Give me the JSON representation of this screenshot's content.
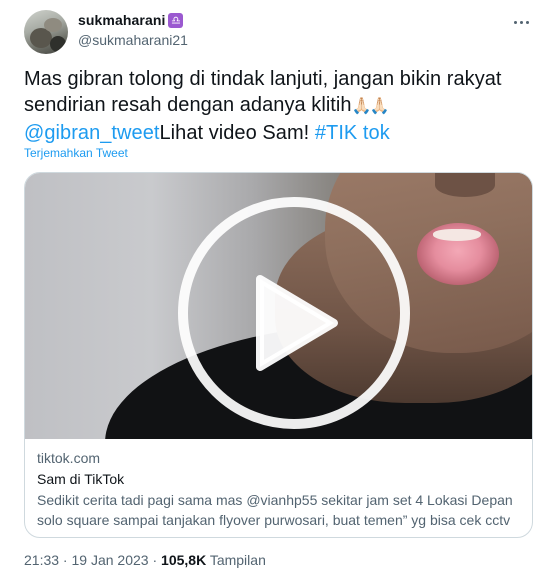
{
  "author": {
    "display_name": "sukmaharani",
    "badge": "♎",
    "handle": "@sukmaharani21",
    "avatar_icon": "avatar"
  },
  "tweet": {
    "text_part1": "Mas gibran tolong di tindak lanjuti, jangan bikin rakyat sendirian resah dengan adanya klitih",
    "emoji": "🙏🏻🙏🏻",
    "mention": "@gibran_tweet",
    "text_part2": "Lihat video Sam! ",
    "hashtag": "#TIK tok",
    "translate_label": "Terjemahkan Tweet"
  },
  "card": {
    "domain": "tiktok.com",
    "title": "Sam di TikTok",
    "description": "Sedikit cerita tadi pagi sama mas @vianhp55 sekitar jam set 4 Lokasi Depan solo square sampai tanjakan flyover purwosari, buat temen” yg bisa cek cctv ...",
    "play_icon": "play-icon"
  },
  "footer": {
    "time": "21:33",
    "sep1": " · ",
    "date": "19 Jan 2023",
    "sep2": " · ",
    "views": "105,8K",
    "views_label": " Tampilan"
  },
  "colors": {
    "link": "#1d9bf0",
    "secondary_text": "#536471",
    "primary_text": "#0f1419",
    "border": "#cfd9de"
  }
}
